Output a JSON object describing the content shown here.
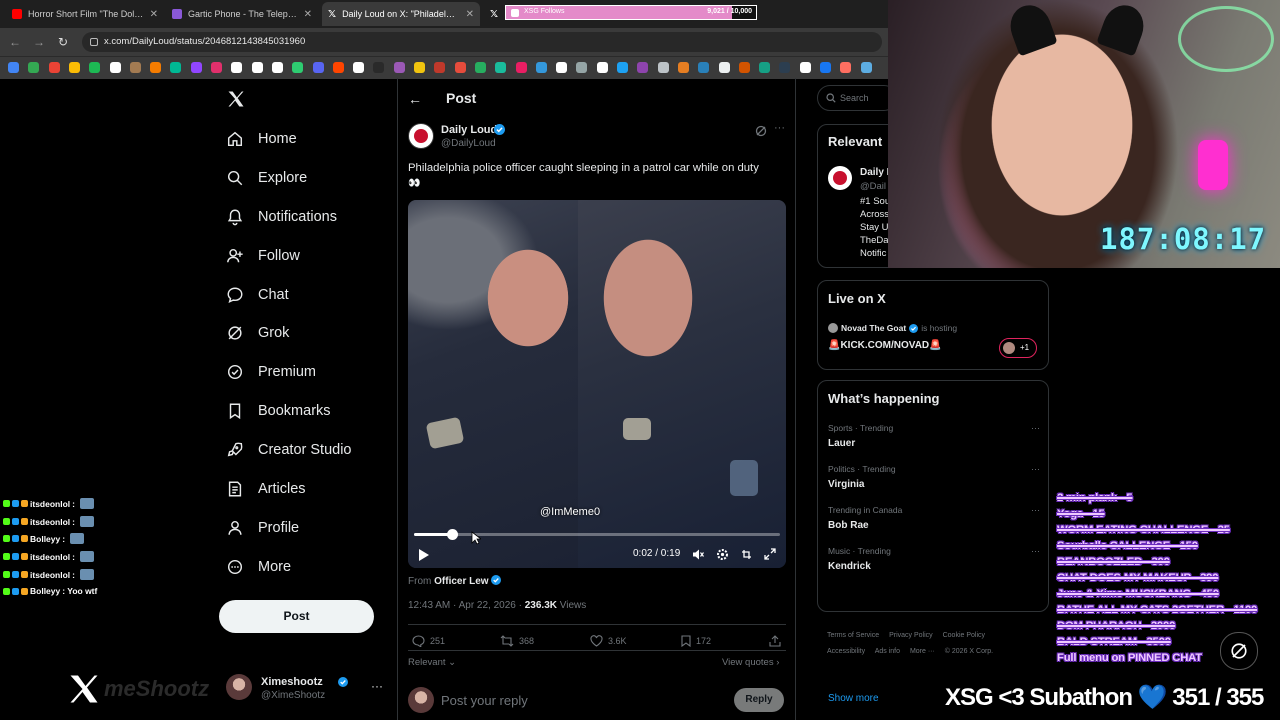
{
  "browser": {
    "tabs": [
      {
        "title": "Horror Short Film \"The Dollmak",
        "favicon_color": "#ff0000"
      },
      {
        "title": "Gartic Phone - The Telephone G",
        "favicon_color": "#8a58d8"
      },
      {
        "title": "Daily Loud on X: \"Philadelphia p",
        "favicon_color": "#ffffff"
      },
      {
        "title": "",
        "favicon_color": "#ffffff"
      }
    ],
    "xsg_follows_label": "XSG Follows",
    "xsg_follows_count": "9,021 / 10,000",
    "xsg_follows_progress": 0.9021,
    "url": "x.com/DailyLoud/status/2046812143845031960"
  },
  "nav": {
    "items": [
      {
        "label": "Home",
        "icon": "home-icon"
      },
      {
        "label": "Explore",
        "icon": "search-icon"
      },
      {
        "label": "Notifications",
        "icon": "bell-icon"
      },
      {
        "label": "Follow",
        "icon": "add-person-icon"
      },
      {
        "label": "Chat",
        "icon": "chat-bubble-icon"
      },
      {
        "label": "Grok",
        "icon": "grok-icon"
      },
      {
        "label": "Premium",
        "icon": "premium-icon"
      },
      {
        "label": "Bookmarks",
        "icon": "bookmark-icon"
      },
      {
        "label": "Creator Studio",
        "icon": "rocket-icon"
      },
      {
        "label": "Articles",
        "icon": "articles-icon"
      },
      {
        "label": "Profile",
        "icon": "person-icon"
      },
      {
        "label": "More",
        "icon": "more-circle-icon"
      }
    ],
    "post_button": "Post",
    "account": {
      "name": "Ximeshootz",
      "handle": "@XimeShootz"
    }
  },
  "post": {
    "header_title": "Post",
    "author_name": "Daily Loud",
    "author_handle": "@DailyLoud",
    "text": "Philadelphia police officer caught sleeping in a patrol car while on duty",
    "emoji": "👀",
    "video": {
      "watermark": "@ImMeme0",
      "time": "0:02 / 0:19",
      "progress": 0.105
    },
    "from_label": "From",
    "from_name": "Officer Lew",
    "timestamp": "12:43 AM · Apr 22, 2026 · ",
    "views_count": "236.3K",
    "views_label": "Views",
    "actions": {
      "replies": "251",
      "reposts": "368",
      "likes": "3.6K",
      "bookmarks": "172"
    },
    "sort_label": "Relevant",
    "view_quotes": "View quotes",
    "reply_placeholder": "Post your reply",
    "reply_button": "Reply"
  },
  "sidebar": {
    "search_placeholder": "Search",
    "relevant": {
      "title": "Relevant",
      "name": "Daily L",
      "handle": "@Dail",
      "bio_lines": [
        "#1 Sou",
        "Across",
        "Stay U",
        "TheDa",
        "Notific"
      ]
    },
    "live": {
      "title": "Live on X",
      "host_name": "Novad The Goat",
      "hosting_label": "is hosting",
      "stream_title": "🚨KICK.COM/NOVAD🚨",
      "extra": "+1"
    },
    "happening": {
      "title": "What’s happening",
      "trends": [
        {
          "category": "Sports · Trending",
          "name": "Lauer"
        },
        {
          "category": "Politics · Trending",
          "name": "Virginia"
        },
        {
          "category": "Trending in Canada",
          "name": "Bob Rae"
        },
        {
          "category": "Music · Trending",
          "name": "Kendrick"
        }
      ],
      "show_more": "Show more"
    },
    "footer": [
      "Terms of Service",
      "Privacy Policy",
      "Cookie Policy",
      "Accessibility",
      "Ads info",
      "More ···",
      "© 2026 X Corp."
    ]
  },
  "stream": {
    "timer": "187:08:17",
    "chat": [
      {
        "user": "itsdeonlol",
        "message": ":"
      },
      {
        "user": "itsdeonlol",
        "message": ":"
      },
      {
        "user": "Bolleyy",
        "message": ":"
      },
      {
        "user": "itsdeonlol",
        "message": ":"
      },
      {
        "user": "itsdeonlol",
        "message": ":"
      },
      {
        "user": "Bolleyy",
        "message": ": Yoo wtf"
      }
    ],
    "goals": [
      {
        "text": "2 min plank - 5",
        "done": true
      },
      {
        "text": "Yoga - 15",
        "done": true
      },
      {
        "text": "WORM EATING CHALLENGE - 25",
        "done": true
      },
      {
        "text": "Sourballs CALLENGE - 150",
        "done": true
      },
      {
        "text": "BEANBOOZLED - 300",
        "done": true
      },
      {
        "text": "CHAT DOES MY MAKEUP - 390",
        "done": true
      },
      {
        "text": "June & Xime MUCKBANG - 450",
        "done": true
      },
      {
        "text": "BATHE ALL MY CATS 2GETHER - 1100",
        "done": true
      },
      {
        "text": "DOM PHARAOH - 2000",
        "done": true
      },
      {
        "text": "BALD STREAM - 3500",
        "done": true
      },
      {
        "text": "Full menu on PINNED CHAT",
        "done": false
      }
    ],
    "subathon_label": "XSG <3 Subathon",
    "subathon_count": "351 / 355",
    "overlay_handle": "meShootz"
  }
}
